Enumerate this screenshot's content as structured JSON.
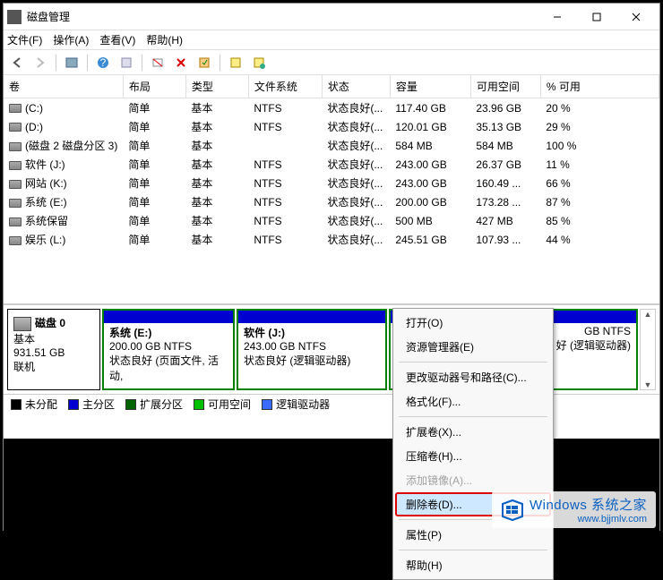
{
  "window": {
    "title": "磁盘管理"
  },
  "menu": {
    "file": "文件(F)",
    "action": "操作(A)",
    "view": "查看(V)",
    "help": "帮助(H)"
  },
  "columns": {
    "volume": "卷",
    "layout": "布局",
    "type": "类型",
    "fs": "文件系统",
    "status": "状态",
    "capacity": "容量",
    "free": "可用空间",
    "pct": "% 可用"
  },
  "volumes": [
    {
      "name": "(C:)",
      "layout": "简单",
      "type": "基本",
      "fs": "NTFS",
      "status": "状态良好(...",
      "capacity": "117.40 GB",
      "free": "23.96 GB",
      "pct": "20 %"
    },
    {
      "name": "(D:)",
      "layout": "简单",
      "type": "基本",
      "fs": "NTFS",
      "status": "状态良好(...",
      "capacity": "120.01 GB",
      "free": "35.13 GB",
      "pct": "29 %"
    },
    {
      "name": "(磁盘 2 磁盘分区 3)",
      "layout": "简单",
      "type": "基本",
      "fs": "",
      "status": "状态良好(...",
      "capacity": "584 MB",
      "free": "584 MB",
      "pct": "100 %"
    },
    {
      "name": "软件 (J:)",
      "layout": "简单",
      "type": "基本",
      "fs": "NTFS",
      "status": "状态良好(...",
      "capacity": "243.00 GB",
      "free": "26.37 GB",
      "pct": "11 %"
    },
    {
      "name": "网站 (K:)",
      "layout": "简单",
      "type": "基本",
      "fs": "NTFS",
      "status": "状态良好(...",
      "capacity": "243.00 GB",
      "free": "160.49 ...",
      "pct": "66 %"
    },
    {
      "name": "系统 (E:)",
      "layout": "简单",
      "type": "基本",
      "fs": "NTFS",
      "status": "状态良好(...",
      "capacity": "200.00 GB",
      "free": "173.28 ...",
      "pct": "87 %"
    },
    {
      "name": "系统保留",
      "layout": "简单",
      "type": "基本",
      "fs": "NTFS",
      "status": "状态良好(...",
      "capacity": "500 MB",
      "free": "427 MB",
      "pct": "85 %"
    },
    {
      "name": "娱乐 (L:)",
      "layout": "简单",
      "type": "基本",
      "fs": "NTFS",
      "status": "状态良好(...",
      "capacity": "245.51 GB",
      "free": "107.93 ...",
      "pct": "44 %"
    }
  ],
  "disk": {
    "label": "磁盘 0",
    "type": "基本",
    "size": "931.51 GB",
    "state": "联机"
  },
  "partitions": [
    {
      "title": "系统 (E:)",
      "size": "200.00 GB NTFS",
      "status": "状态良好 (页面文件, 活动,"
    },
    {
      "title": "软件 (J:)",
      "size": "243.00 GB NTFS",
      "status": "状态良好 (逻辑驱动器)"
    },
    {
      "title": "",
      "size": "GB NTFS",
      "status": "好 (逻辑驱动器)"
    }
  ],
  "legend": {
    "unallocated": "未分配",
    "primary": "主分区",
    "extended": "扩展分区",
    "free": "可用空间",
    "logical": "逻辑驱动器"
  },
  "context_menu": {
    "open": "打开(O)",
    "explorer": "资源管理器(E)",
    "change_letter": "更改驱动器号和路径(C)...",
    "format": "格式化(F)...",
    "extend": "扩展卷(X)...",
    "shrink": "压缩卷(H)...",
    "add_mirror": "添加镜像(A)...",
    "delete": "删除卷(D)...",
    "properties": "属性(P)",
    "help": "帮助(H)"
  },
  "watermark": {
    "line1": "Windows 系统之家",
    "line2": "www.bjjmlv.com"
  }
}
